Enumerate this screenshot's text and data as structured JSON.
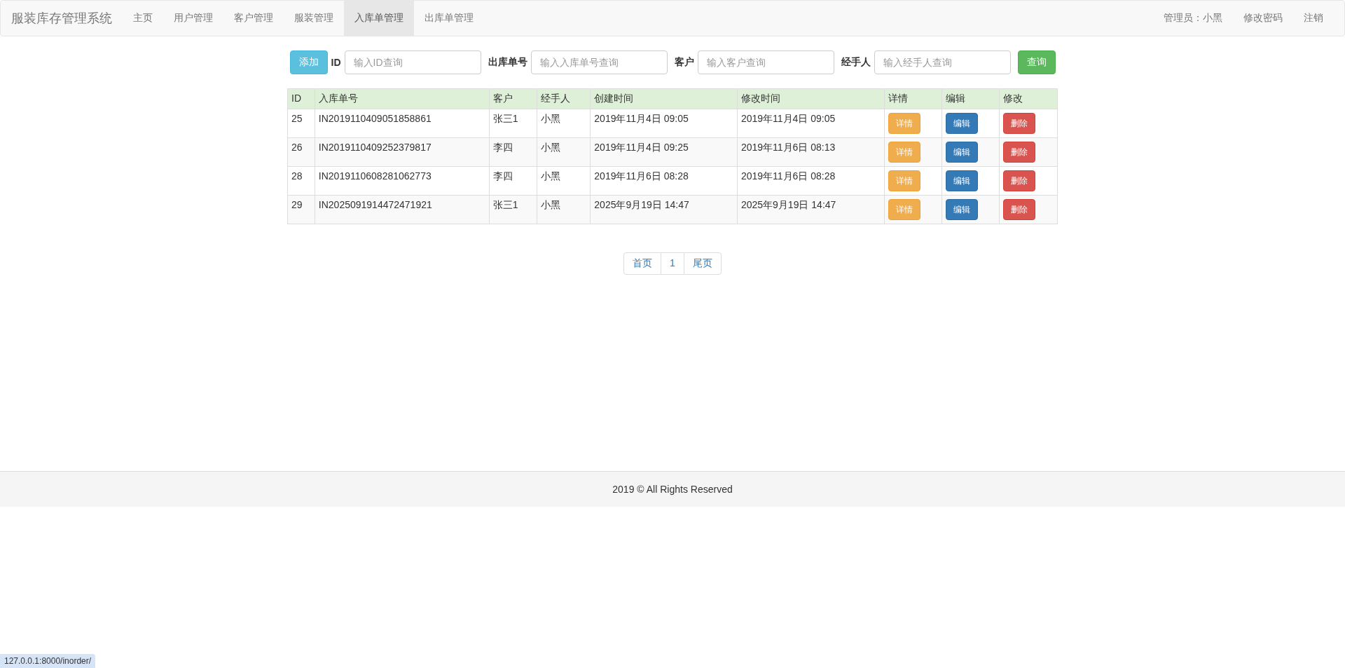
{
  "navbar": {
    "brand": "服装库存管理系统",
    "items": [
      {
        "label": "主页",
        "selected": false
      },
      {
        "label": "用户管理",
        "selected": false
      },
      {
        "label": "客户管理",
        "selected": false
      },
      {
        "label": "服装管理",
        "selected": false
      },
      {
        "label": "入库单管理",
        "selected": true
      },
      {
        "label": "出库单管理",
        "selected": false
      }
    ],
    "right_items": [
      "管理员：小黑",
      "修改密码",
      "注销"
    ]
  },
  "search": {
    "add_button": "添加",
    "fields": [
      {
        "label": "ID",
        "placeholder": "输入ID查询"
      },
      {
        "label": "出库单号",
        "placeholder": "输入入库单号查询"
      },
      {
        "label": "客户",
        "placeholder": "输入客户查询"
      },
      {
        "label": "经手人",
        "placeholder": "输入经手人查询"
      }
    ],
    "query_button": "查询"
  },
  "table": {
    "columns": [
      "ID",
      "入库单号",
      "客户",
      "经手人",
      "创建时间",
      "修改时间",
      "详情",
      "编辑",
      "修改"
    ],
    "rows": [
      {
        "cells": [
          "25",
          "IN2019110409051858861",
          "张三1",
          "小黑",
          "2019年11月4日 09:05",
          "2019年11月4日 09:05"
        ],
        "buttons": [
          {
            "kind": "warning",
            "label": "详情"
          },
          {
            "kind": "primary",
            "label": "编辑"
          },
          {
            "kind": "danger",
            "label": "删除"
          }
        ]
      },
      {
        "cells": [
          "26",
          "IN2019110409252379817",
          "李四",
          "小黑",
          "2019年11月4日 09:25",
          "2019年11月6日 08:13"
        ],
        "buttons": [
          {
            "kind": "warning",
            "label": "详情"
          },
          {
            "kind": "primary",
            "label": "编辑"
          },
          {
            "kind": "danger",
            "label": "删除"
          }
        ]
      },
      {
        "cells": [
          "28",
          "IN2019110608281062773",
          "李四",
          "小黑",
          "2019年11月6日 08:28",
          "2019年11月6日 08:28"
        ],
        "buttons": [
          {
            "kind": "warning",
            "label": "详情"
          },
          {
            "kind": "primary",
            "label": "编辑"
          },
          {
            "kind": "danger",
            "label": "删除"
          }
        ]
      },
      {
        "cells": [
          "29",
          "IN2025091914472471921",
          "张三1",
          "小黑",
          "2025年9月19日 14:47",
          "2025年9月19日 14:47"
        ],
        "buttons": [
          {
            "kind": "warning",
            "label": "详情"
          },
          {
            "kind": "primary",
            "label": "编辑"
          },
          {
            "kind": "danger",
            "label": "删除"
          }
        ]
      }
    ]
  },
  "pagination": [
    "首页",
    "1",
    "尾页"
  ],
  "footer": "2019 © All Rights Reserved",
  "status_bar": {
    "url": "127.0.0.1:8000/inorder/"
  }
}
